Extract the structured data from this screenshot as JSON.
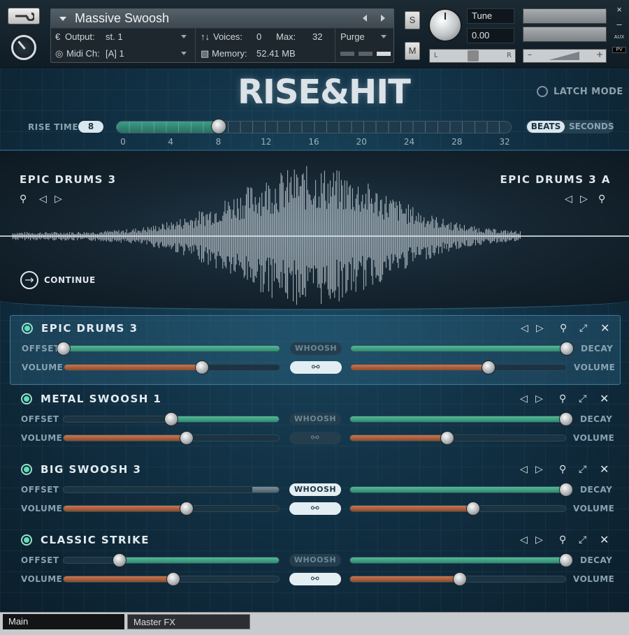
{
  "kontakt": {
    "instrument_name": "Massive Swoosh",
    "output_label": "Output:",
    "output_value": "st. 1",
    "voices_label": "Voices:",
    "voices_value": "0",
    "max_label": "Max:",
    "max_value": "32",
    "purge_label": "Purge",
    "midi_label": "Midi Ch:",
    "midi_value": "[A]  1",
    "memory_label": "Memory:",
    "memory_value": "52.41 MB",
    "solo_label": "S",
    "mute_label": "M",
    "tune_label": "Tune",
    "tune_value": "0.00",
    "pan_left": "L",
    "pan_right": "R",
    "vol_minus": "–",
    "vol_plus": "+",
    "close_label": "×",
    "minimize_label": "–",
    "aux_label": "AUX",
    "pv_label": "PV"
  },
  "rise_hit": {
    "title": "RISE&HIT",
    "latch_label": "LATCH MODE",
    "rise_time_label": "RISE TIME",
    "rise_time_value": "8",
    "rise_time_max": 32,
    "rise_scale": [
      "0",
      "4",
      "8",
      "12",
      "16",
      "20",
      "24",
      "28",
      "32"
    ],
    "unit_beats": "BEATS",
    "unit_seconds": "SECONDS",
    "left_source": "EPIC DRUMS 3",
    "right_source": "EPIC DRUMS 3 A",
    "continue_label": "CONTINUE"
  },
  "layers": [
    {
      "name": "EPIC DRUMS 3",
      "selected": true,
      "offset": 0.0,
      "decay": 1.0,
      "vol_left": 0.64,
      "vol_right": 0.64,
      "whoosh_on": false,
      "link_on": true
    },
    {
      "name": "METAL SWOOSH 1",
      "selected": false,
      "offset": 0.5,
      "decay": 1.0,
      "vol_left": 0.57,
      "vol_right": 0.45,
      "whoosh_on": false,
      "link_on": false
    },
    {
      "name": "BIG SWOOSH 3",
      "selected": false,
      "offset": null,
      "decay": 1.0,
      "vol_left": 0.57,
      "vol_right": 0.57,
      "whoosh_on": true,
      "link_on": true
    },
    {
      "name": "CLASSIC STRIKE",
      "selected": false,
      "offset": 0.26,
      "decay": 1.0,
      "vol_left": 0.51,
      "vol_right": 0.51,
      "whoosh_on": false,
      "link_on": true
    }
  ],
  "labels": {
    "offset": "OFFSET",
    "decay": "DECAY",
    "volume": "VOLUME",
    "whoosh": "WHOOSH"
  },
  "tabs": [
    {
      "label": "Main",
      "active": true
    },
    {
      "label": "Master FX",
      "active": false
    }
  ]
}
